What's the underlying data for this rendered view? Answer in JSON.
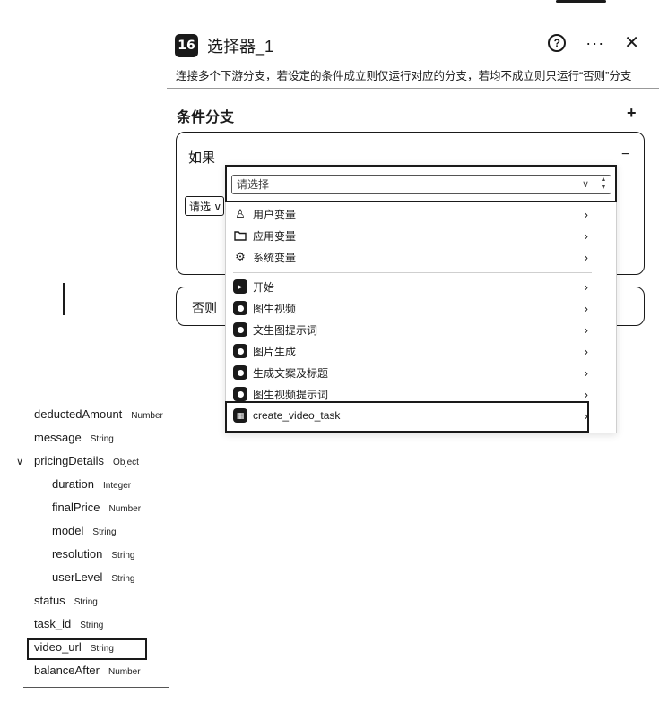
{
  "panel": {
    "logo_text": "16",
    "title": "选择器_1",
    "description": "连接多个下游分支，若设定的条件成立则仅运行对应的分支，若均不成立则只运行“否则”分支",
    "help_glyph": "?",
    "more_glyph": "···",
    "close_glyph": "✕"
  },
  "branches": {
    "section_title": "条件分支",
    "add_glyph": "+",
    "if_label": "如果",
    "collapse_glyph": "−",
    "partial_select_text": "请选 ∨",
    "else_label": "否则"
  },
  "dropdown": {
    "placeholder": "请选择",
    "chevron_glyph": "∨",
    "stepper_up": "▲",
    "stepper_down": "▼",
    "option_chevron": "›",
    "options": [
      {
        "label": "用户变量",
        "icon": "user-icon"
      },
      {
        "label": "应用变量",
        "icon": "folder-icon"
      },
      {
        "label": "系统变量",
        "icon": "gear-icon"
      },
      {
        "label": "开始",
        "icon": "start-node-icon"
      },
      {
        "label": "图生视频",
        "icon": "node-icon"
      },
      {
        "label": "文生图提示词",
        "icon": "node-icon"
      },
      {
        "label": "图片生成",
        "icon": "node-icon"
      },
      {
        "label": "生成文案及标题",
        "icon": "node-icon"
      },
      {
        "label": "图生视频提示词",
        "icon": "node-icon"
      },
      {
        "label": "create_video_task",
        "icon": "plugin-icon"
      }
    ]
  },
  "variable_tree": {
    "expand_glyph": "∨",
    "rows": [
      {
        "name": "deductedAmount",
        "type": "Number"
      },
      {
        "name": "message",
        "type": "String"
      },
      {
        "name": "pricingDetails",
        "type": "Object"
      },
      {
        "name": "duration",
        "type": "Integer"
      },
      {
        "name": "finalPrice",
        "type": "Number"
      },
      {
        "name": "model",
        "type": "String"
      },
      {
        "name": "resolution",
        "type": "String"
      },
      {
        "name": "userLevel",
        "type": "String"
      },
      {
        "name": "status",
        "type": "String"
      },
      {
        "name": "task_id",
        "type": "String"
      },
      {
        "name": "video_url",
        "type": "String"
      },
      {
        "name": "balanceAfter",
        "type": "Number"
      }
    ]
  }
}
